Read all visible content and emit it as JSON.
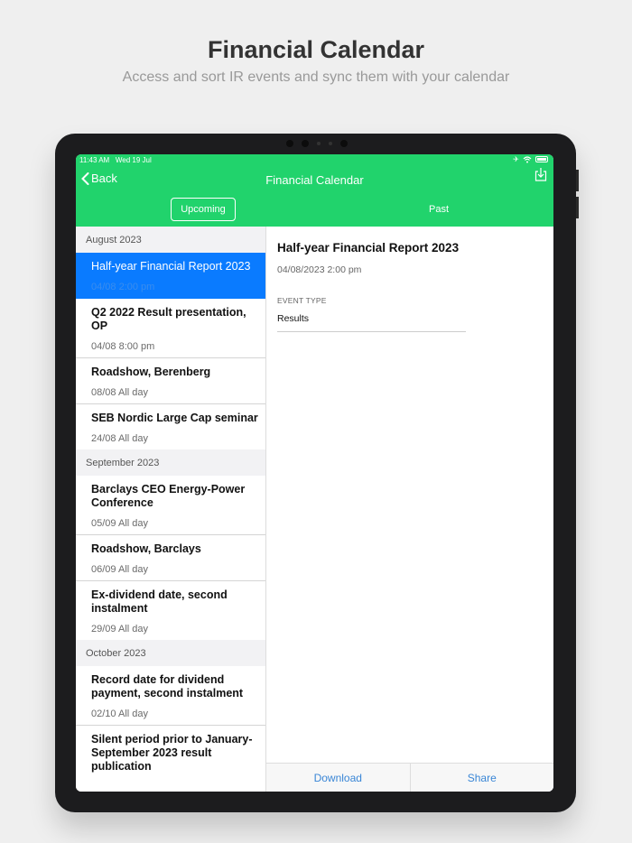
{
  "promo": {
    "title": "Financial Calendar",
    "subtitle": "Access and sort IR events and sync them with your calendar"
  },
  "status_bar": {
    "time": "11:43 AM",
    "date": "Wed 19 Jul"
  },
  "nav": {
    "back_label": "Back",
    "title": "Financial Calendar",
    "segments": [
      "Upcoming",
      "Past"
    ],
    "active_segment": "Upcoming"
  },
  "sections": [
    {
      "header": "August 2023",
      "items": [
        {
          "title": "Half-year Financial Report 2023",
          "meta": "04/08 2:00 pm",
          "selected": true
        },
        {
          "title": "Q2 2022 Result presentation, OP",
          "meta": "04/08 8:00 pm"
        },
        {
          "title": "Roadshow, Berenberg",
          "meta": "08/08 All day"
        },
        {
          "title": "SEB Nordic Large Cap seminar",
          "meta": "24/08 All day"
        }
      ]
    },
    {
      "header": "September 2023",
      "items": [
        {
          "title": "Barclays CEO Energy-Power Conference",
          "meta": "05/09 All day"
        },
        {
          "title": "Roadshow, Barclays",
          "meta": "06/09 All day"
        },
        {
          "title": "Ex-dividend date, second instalment",
          "meta": "29/09 All day"
        }
      ]
    },
    {
      "header": "October 2023",
      "items": [
        {
          "title": "Record date for dividend payment, second instalment",
          "meta": "02/10 All day"
        },
        {
          "title": "Silent period prior to January-September 2023 result publication",
          "meta": ""
        }
      ]
    }
  ],
  "detail": {
    "title": "Half-year Financial Report 2023",
    "date": "04/08/2023 2:00 pm",
    "event_type_label": "EVENT TYPE",
    "event_type_value": "Results"
  },
  "footer": {
    "download_label": "Download",
    "share_label": "Share"
  },
  "colors": {
    "header": "#21d36c",
    "selected": "#0a7bff",
    "link": "#3a86d6"
  },
  "icons": [
    "chevron-left-icon",
    "export-icon",
    "airplane-icon",
    "wifi-icon",
    "battery-icon"
  ]
}
